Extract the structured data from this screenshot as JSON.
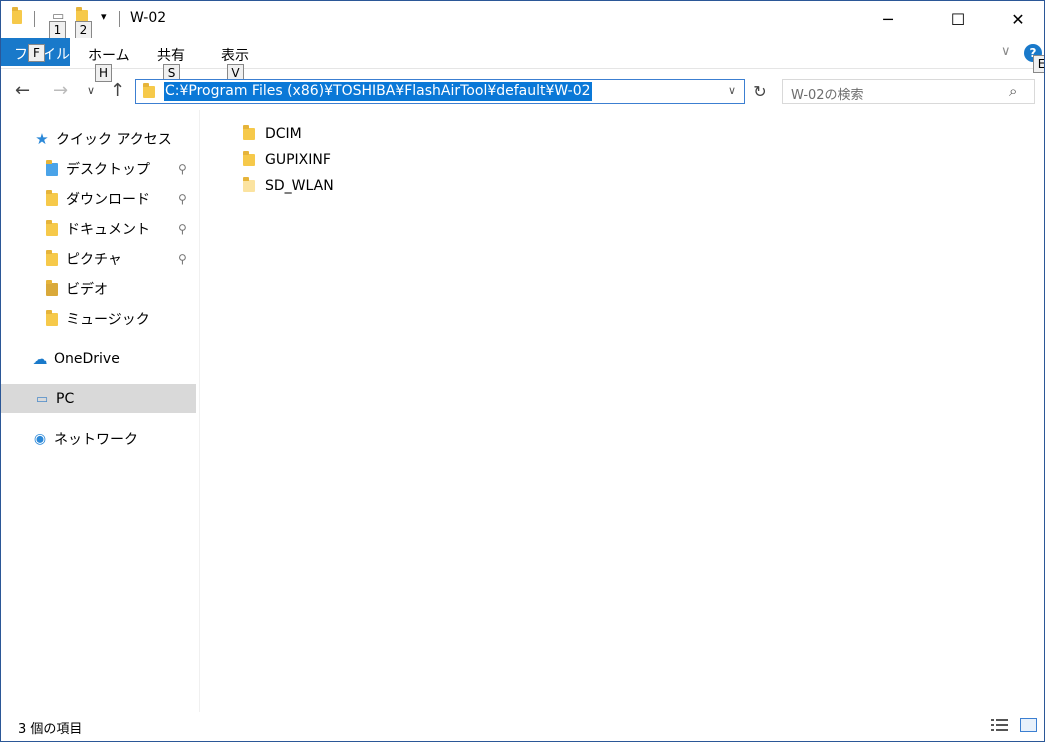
{
  "window": {
    "title": "W-02",
    "minimize_label": "─",
    "maximize_label": "☐",
    "close_label": "✕"
  },
  "quick_access_toolbar": {
    "dropdown_glyph": "▾",
    "keytips": [
      "1",
      "2"
    ]
  },
  "ribbon": {
    "file_tab": "ファイル",
    "file_keytip": "F",
    "tabs": [
      {
        "label": "ホーム",
        "keytip": "H"
      },
      {
        "label": "共有",
        "keytip": "S"
      },
      {
        "label": "表示",
        "keytip": "V"
      }
    ],
    "expand_glyph": "∨",
    "help_glyph": "?",
    "help_keytip": "E"
  },
  "navigation": {
    "back_glyph": "←",
    "forward_glyph": "→",
    "recent_glyph": "∨",
    "up_glyph": "↑",
    "address_path": "C:¥Program Files (x86)¥TOSHIBA¥FlashAirTool¥default¥W-02",
    "address_dropdown_glyph": "∨",
    "refresh_glyph": "↻",
    "search_placeholder": "W-02の検索",
    "search_glyph": "⌕"
  },
  "nav_pane": {
    "quick_access": "クイック アクセス",
    "items": [
      {
        "label": "デスクトップ",
        "pinned": true
      },
      {
        "label": "ダウンロード",
        "pinned": true
      },
      {
        "label": "ドキュメント",
        "pinned": true
      },
      {
        "label": "ピクチャ",
        "pinned": true
      },
      {
        "label": "ビデオ",
        "pinned": false
      },
      {
        "label": "ミュージック",
        "pinned": false
      }
    ],
    "onedrive": "OneDrive",
    "pc": "PC",
    "network": "ネットワーク",
    "pin_glyph": "📌"
  },
  "files": [
    {
      "name": "DCIM"
    },
    {
      "name": "GUPIXINF"
    },
    {
      "name": "SD_WLAN"
    }
  ],
  "status": {
    "item_count": "3 個の項目"
  },
  "colors": {
    "accent": "#1979ca",
    "selection": "#0a78d7",
    "folder": "#f6c94a"
  }
}
